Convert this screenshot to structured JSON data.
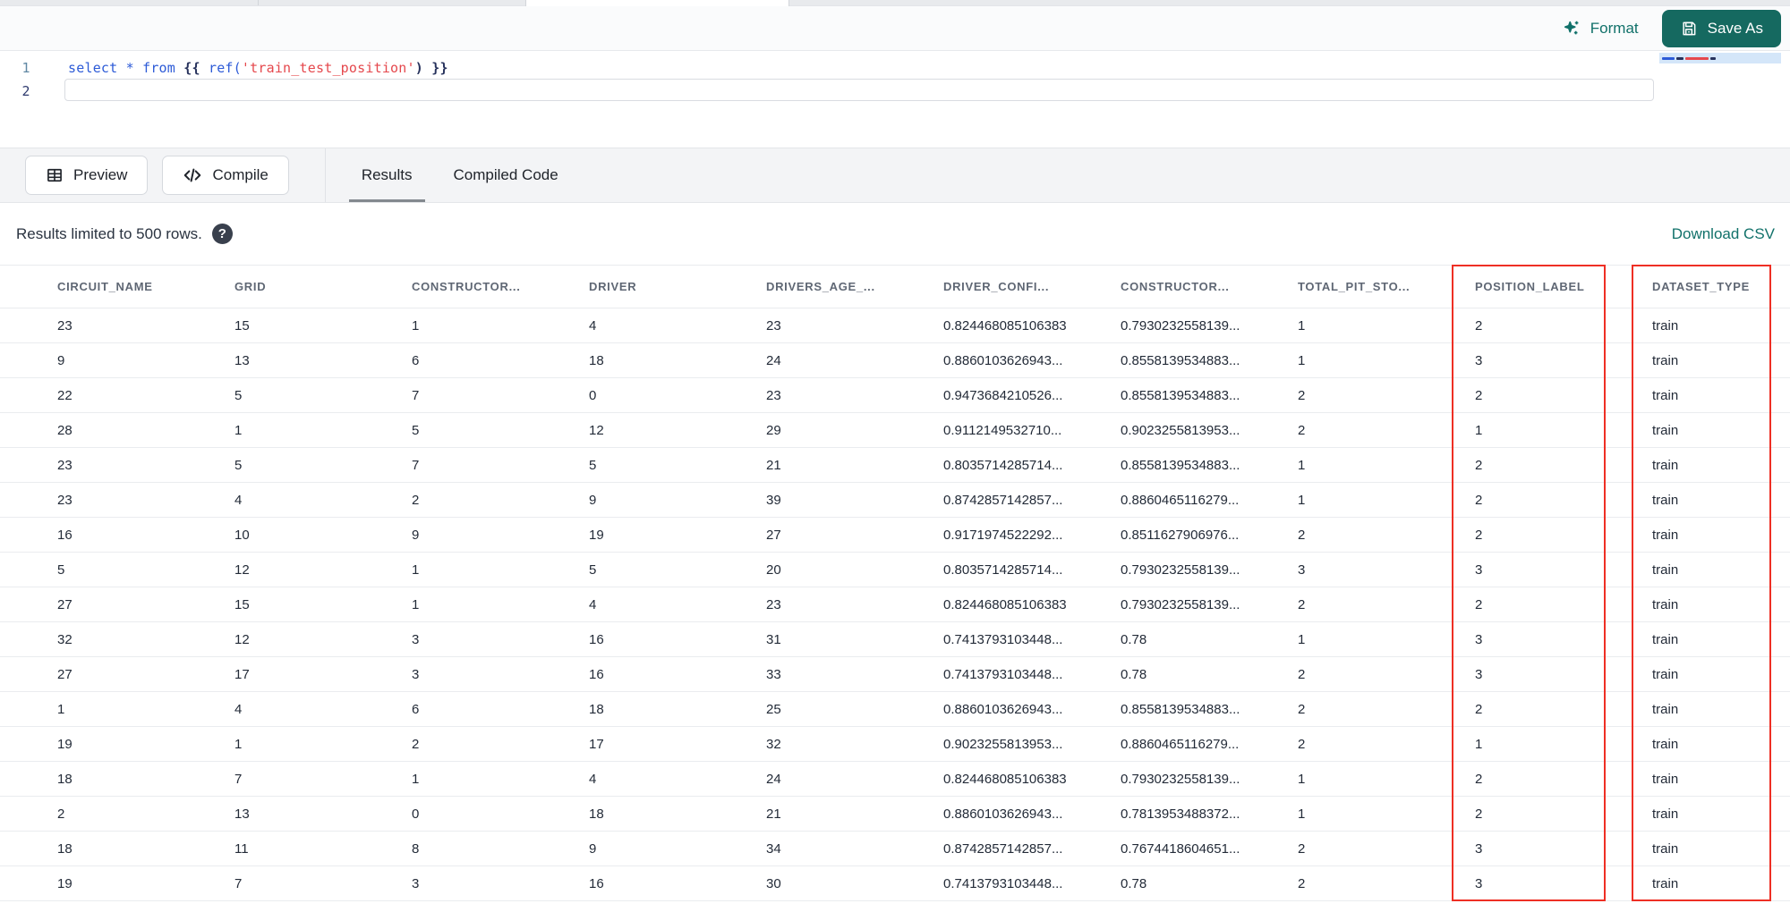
{
  "editor_toolbar": {
    "format_label": "Format",
    "save_as_label": "Save As"
  },
  "editor": {
    "line_numbers": [
      "1",
      "2"
    ],
    "line1_text": "select * from {{ ref('train_test_position') }}",
    "line1_tokens": [
      {
        "text": "select",
        "type": "keyword"
      },
      {
        "text": " ",
        "type": "plain"
      },
      {
        "text": "*",
        "type": "operator"
      },
      {
        "text": " ",
        "type": "plain"
      },
      {
        "text": "from",
        "type": "keyword"
      },
      {
        "text": " ",
        "type": "plain"
      },
      {
        "text": "{{",
        "type": "brace"
      },
      {
        "text": " ",
        "type": "plain"
      },
      {
        "text": "ref",
        "type": "function"
      },
      {
        "text": "(",
        "type": "function"
      },
      {
        "text": "'train_test_position'",
        "type": "string"
      },
      {
        "text": ")",
        "type": "brace"
      },
      {
        "text": " ",
        "type": "plain"
      },
      {
        "text": "}}",
        "type": "brace"
      }
    ]
  },
  "actions_bar": {
    "preview_label": "Preview",
    "compile_label": "Compile",
    "tabs": [
      {
        "label": "Results",
        "active": true
      },
      {
        "label": "Compiled Code",
        "active": false
      }
    ]
  },
  "results_bar": {
    "info_text": "Results limited to 500 rows.",
    "help_icon": "?",
    "download_label": "Download CSV"
  },
  "table": {
    "columns": [
      "CIRCUIT_NAME",
      "GRID",
      "CONSTRUCTOR...",
      "DRIVER",
      "DRIVERS_AGE_...",
      "DRIVER_CONFI...",
      "CONSTRUCTOR...",
      "TOTAL_PIT_STO...",
      "POSITION_LABEL",
      "DATASET_TYPE"
    ],
    "highlighted_columns": [
      "POSITION_LABEL",
      "DATASET_TYPE"
    ],
    "rows": [
      [
        "23",
        "15",
        "1",
        "4",
        "23",
        "0.824468085106383",
        "0.7930232558139...",
        "1",
        "2",
        "train"
      ],
      [
        "9",
        "13",
        "6",
        "18",
        "24",
        "0.8860103626943...",
        "0.8558139534883...",
        "1",
        "3",
        "train"
      ],
      [
        "22",
        "5",
        "7",
        "0",
        "23",
        "0.9473684210526...",
        "0.8558139534883...",
        "2",
        "2",
        "train"
      ],
      [
        "28",
        "1",
        "5",
        "12",
        "29",
        "0.9112149532710...",
        "0.9023255813953...",
        "2",
        "1",
        "train"
      ],
      [
        "23",
        "5",
        "7",
        "5",
        "21",
        "0.8035714285714...",
        "0.8558139534883...",
        "1",
        "2",
        "train"
      ],
      [
        "23",
        "4",
        "2",
        "9",
        "39",
        "0.8742857142857...",
        "0.8860465116279...",
        "1",
        "2",
        "train"
      ],
      [
        "16",
        "10",
        "9",
        "19",
        "27",
        "0.9171974522292...",
        "0.8511627906976...",
        "2",
        "2",
        "train"
      ],
      [
        "5",
        "12",
        "1",
        "5",
        "20",
        "0.8035714285714...",
        "0.7930232558139...",
        "3",
        "3",
        "train"
      ],
      [
        "27",
        "15",
        "1",
        "4",
        "23",
        "0.824468085106383",
        "0.7930232558139...",
        "2",
        "2",
        "train"
      ],
      [
        "32",
        "12",
        "3",
        "16",
        "31",
        "0.7413793103448...",
        "0.78",
        "1",
        "3",
        "train"
      ],
      [
        "27",
        "17",
        "3",
        "16",
        "33",
        "0.7413793103448...",
        "0.78",
        "2",
        "3",
        "train"
      ],
      [
        "1",
        "4",
        "6",
        "18",
        "25",
        "0.8860103626943...",
        "0.8558139534883...",
        "2",
        "2",
        "train"
      ],
      [
        "19",
        "1",
        "2",
        "17",
        "32",
        "0.9023255813953...",
        "0.8860465116279...",
        "2",
        "1",
        "train"
      ],
      [
        "18",
        "7",
        "1",
        "4",
        "24",
        "0.824468085106383",
        "0.7930232558139...",
        "1",
        "2",
        "train"
      ],
      [
        "2",
        "13",
        "0",
        "18",
        "21",
        "0.8860103626943...",
        "0.7813953488372...",
        "1",
        "2",
        "train"
      ],
      [
        "18",
        "11",
        "8",
        "9",
        "34",
        "0.8742857142857...",
        "0.7674418604651...",
        "2",
        "3",
        "train"
      ],
      [
        "19",
        "7",
        "3",
        "16",
        "30",
        "0.7413793103448...",
        "0.78",
        "2",
        "3",
        "train"
      ]
    ]
  },
  "colors": {
    "accent-teal": "#11716a",
    "button-teal": "#156960",
    "highlight-red": "#ee2f24",
    "code-keyword": "#2d5bd7",
    "code-string": "#e5484d",
    "code-brace": "#27325c"
  }
}
